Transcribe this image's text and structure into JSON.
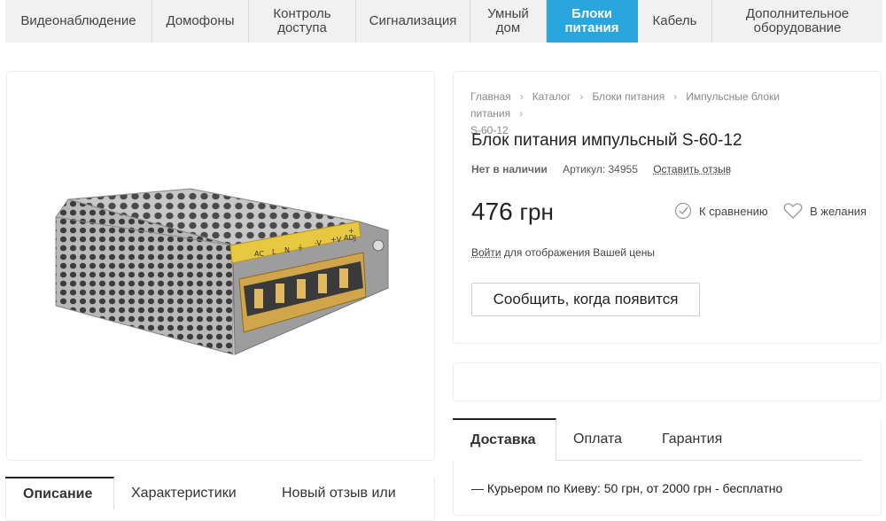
{
  "nav": {
    "items": [
      "Видеонаблюдение",
      "Домофоны",
      "Контроль доступа",
      "Сигнализация",
      "Умный дом",
      "Блоки питания",
      "Кабель",
      "Дополнительное оборудование"
    ],
    "active_index": 5
  },
  "product": {
    "breadcrumb": [
      "Главная",
      "Каталог",
      "Блоки питания",
      "Импульсные блоки питания",
      "S-60-12"
    ],
    "title": "Блок питания импульсный S-60-12",
    "stock": "Нет в наличии",
    "article": "Артикул: 34955",
    "review_link": "Оставить отзыв",
    "price": "476",
    "currency": "грн",
    "compare": "К сравнению",
    "wishlist": "В желания",
    "login_link": "Войти",
    "login_rest": " для отображения Вашей цены",
    "notify_button": "Сообщить, когда появится",
    "image_labels": [
      "AC",
      "L",
      "N",
      "⏚",
      "-V",
      "+V",
      "+",
      "ADJ"
    ]
  },
  "info_tabs": [
    "Доставка",
    "Оплата",
    "Гарантия"
  ],
  "delivery_text": "— Курьером по Киеву: 50 грн, от 2000 грн - бесплатно",
  "desc_tabs": [
    "Описание",
    "Характеристики",
    "Новый отзыв или"
  ],
  "colors": {
    "accent": "#2aa6df",
    "nav_bg": "#f1f1f1"
  }
}
